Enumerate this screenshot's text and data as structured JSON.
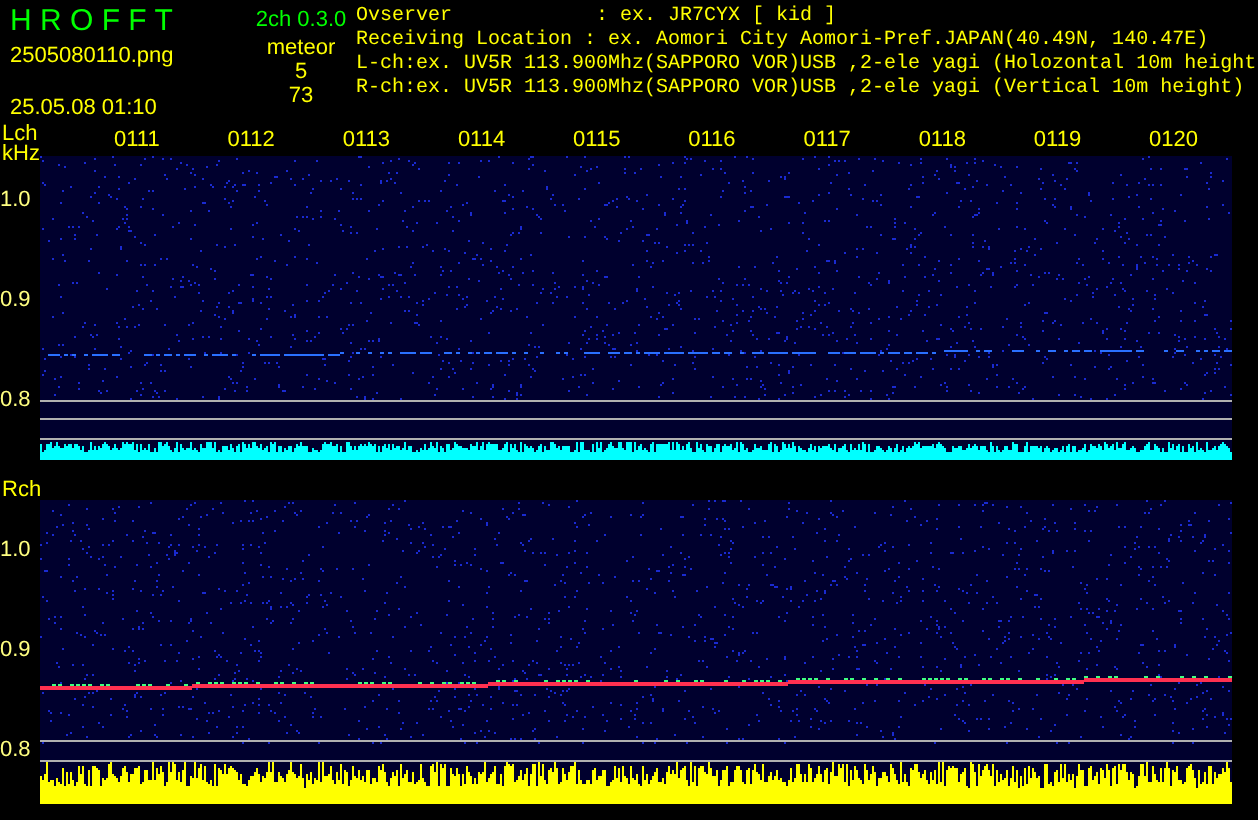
{
  "header": {
    "app_title": "H R O F F T",
    "version": "2ch 0.3.0",
    "filename": "2505080110.png",
    "datetime": "25.05.08 01:10",
    "detection_label": "meteor",
    "counts": [
      "5",
      "73"
    ],
    "info_lines": [
      "Ovserver            : ex. JR7CYX [ kid ]",
      "Receiving Location : ex. Aomori City Aomori-Pref.JAPAN(40.49N, 140.47E)",
      "L-ch:ex. UV5R 113.900Mhz(SAPPORO VOR)USB ,2-ele yagi (Holozontal 10m height",
      "R-ch:ex. UV5R 113.900Mhz(SAPPORO VOR)USB ,2-ele yagi (Vertical 10m height)"
    ]
  },
  "panels": [
    {
      "label": "Lch",
      "unit": "kHz",
      "time_labels": [
        "0111",
        "0112",
        "0113",
        "0114",
        "0115",
        "0116",
        "0117",
        "0118",
        "0119",
        "0120"
      ],
      "y_labels": [
        "1.0",
        "0.9",
        "0.8"
      ],
      "color": "#00ffff"
    },
    {
      "label": "Rch",
      "y_labels": [
        "1.0",
        "0.9",
        "0.8"
      ],
      "color": "#ffff00"
    }
  ]
}
